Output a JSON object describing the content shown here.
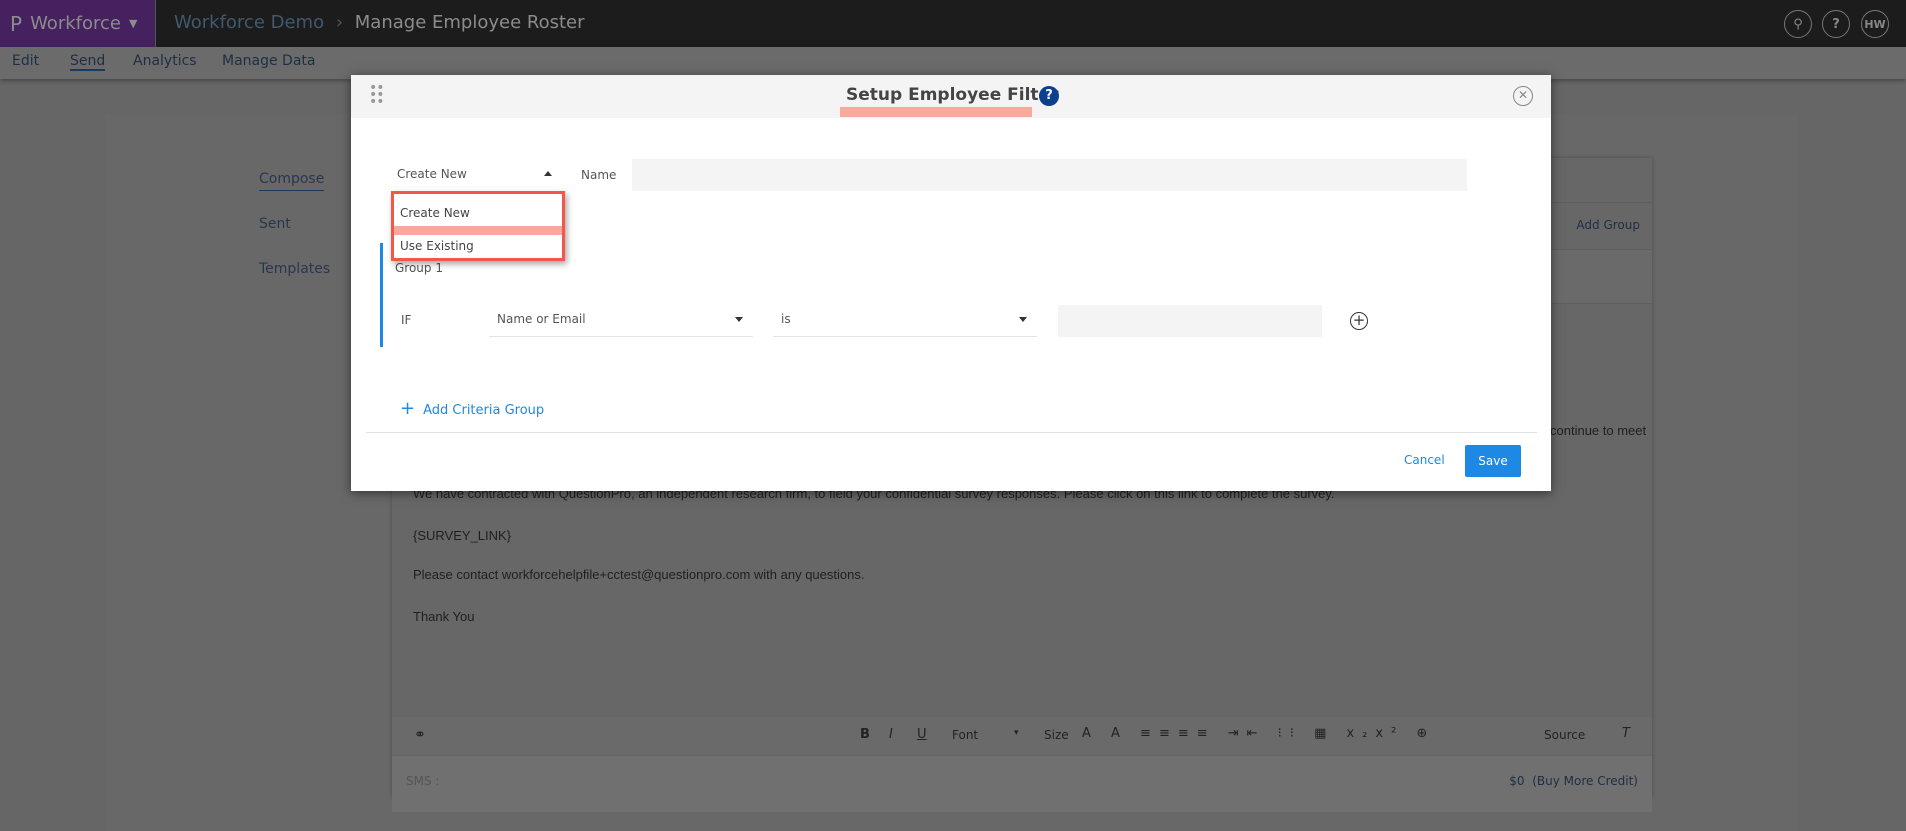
{
  "topbar": {
    "brand": "Workforce",
    "breadcrumb_parent": "Workforce Demo",
    "breadcrumb_current": "Manage Employee Roster",
    "avatar": "HW"
  },
  "subnav": {
    "items": [
      "Edit",
      "Send",
      "Analytics",
      "Manage Data"
    ],
    "active": "Send"
  },
  "sidebar": {
    "items": [
      "Compose",
      "Sent",
      "Templates"
    ]
  },
  "background": {
    "add_group": "Add Group",
    "line1_tail": "continue to meet",
    "line2": "We have contracted with QuestionPro, an independent research firm, to field your confidential survey responses. Please click on this link to complete the survey.",
    "survey_link": "{SURVEY_LINK}",
    "contact": "Please contact workforcehelpfile+cctest@questionpro.com with any questions.",
    "thanks": "Thank You",
    "toolbar": {
      "font": "Font",
      "size": "Size",
      "source": "Source",
      "bold": "B",
      "italic": "I",
      "underline": "U"
    },
    "sms_label": "SMS :",
    "credit": "$0",
    "buy_credit": "(Buy More Credit)"
  },
  "modal": {
    "title": "Setup Employee Filter",
    "mode_selected": "Create New",
    "mode_options": [
      "Create New",
      "Use Existing"
    ],
    "name_label": "Name",
    "name_value": "",
    "group_label": "Group 1",
    "if_label": "IF",
    "field_select": "Name or Email",
    "operator_select": "is",
    "value": "",
    "add_criteria": "Add Criteria Group",
    "cancel": "Cancel",
    "save": "Save"
  },
  "colors": {
    "accent": "#1e88e5",
    "brand": "#45215f",
    "highlight": "#f44336"
  }
}
